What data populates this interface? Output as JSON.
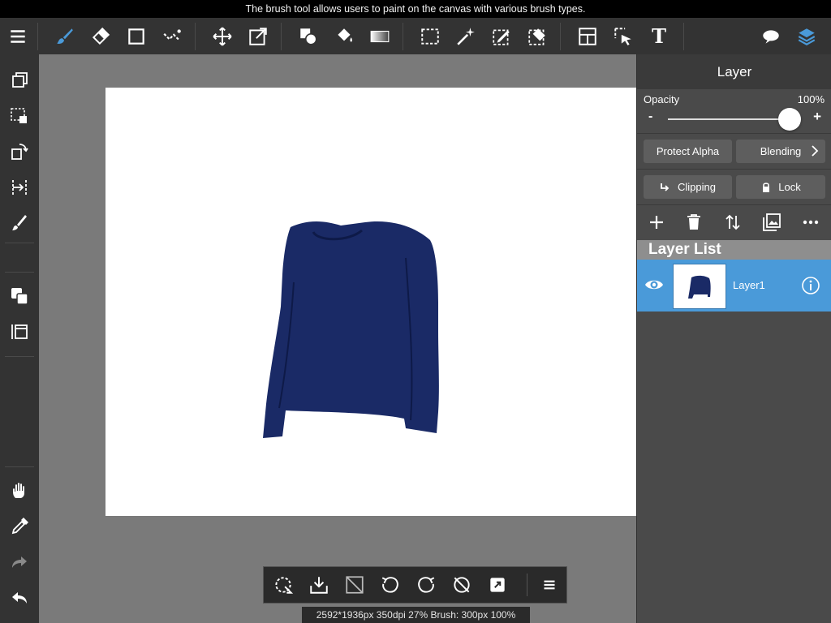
{
  "tooltip": "The brush tool allows users to paint on the canvas with various brush types.",
  "toolbar": {
    "tools": [
      {
        "name": "menu-icon"
      },
      {
        "name": "brush-icon",
        "active": true
      },
      {
        "name": "eraser-icon"
      },
      {
        "name": "rectangle-shape-icon"
      },
      {
        "name": "smudge-icon"
      },
      {
        "name": "move-icon"
      },
      {
        "name": "transform-icon"
      },
      {
        "name": "fill-shape-icon"
      },
      {
        "name": "bucket-icon"
      },
      {
        "name": "gradient-icon"
      },
      {
        "name": "select-rect-icon"
      },
      {
        "name": "magic-wand-icon"
      },
      {
        "name": "selection-pen-icon"
      },
      {
        "name": "selection-eraser-icon"
      },
      {
        "name": "frame-divider-icon"
      },
      {
        "name": "operation-icon"
      },
      {
        "name": "text-icon"
      },
      {
        "name": "speech-balloon-icon"
      },
      {
        "name": "layers-icon",
        "active": true
      }
    ],
    "text_tool_label": "T"
  },
  "sidebar": {
    "tools": [
      "duplicate-icon",
      "selection-copy-icon",
      "rotate-icon",
      "flip-icon",
      "brush-small-icon",
      "color-swatch-icon",
      "canvas-icon",
      "hand-icon",
      "eyedropper-icon",
      "redo-icon",
      "undo-icon"
    ]
  },
  "layer_panel": {
    "title": "Layer",
    "opacity_label": "Opacity",
    "opacity_value": "100%",
    "opacity_fraction": 1.0,
    "minus": "-",
    "plus": "+",
    "protect_alpha": "Protect Alpha",
    "blending": "Blending",
    "clipping": "Clipping",
    "lock": "Lock",
    "actions": [
      "add-layer-icon",
      "delete-layer-icon",
      "move-layer-icon",
      "image-layer-icon",
      "more-icon"
    ],
    "list_title": "Layer List",
    "layers": [
      {
        "name": "Layer1",
        "visible": true,
        "selected": true
      }
    ]
  },
  "bottom_bar": {
    "tools": [
      "lasso-rotate-icon",
      "save-icon",
      "clear-icon",
      "undo-rotate-icon",
      "redo-rotate-icon",
      "no-rotate-icon",
      "export-icon",
      "hamburger-icon"
    ]
  },
  "status": "2592*1936px 350dpi 27% Brush: 300px 100%",
  "colors": {
    "toolbar_bg": "#333333",
    "accent": "#4a9ad9",
    "workspace_bg": "#7a7a7a",
    "canvas_bg": "#ffffff",
    "sweater": "#1a2a66"
  }
}
